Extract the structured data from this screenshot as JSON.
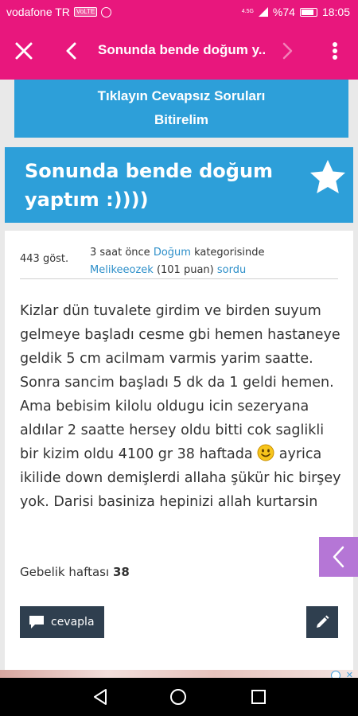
{
  "status_bar": {
    "carrier": "vodafone TR",
    "volte": "VoLTE",
    "network": "4.5G",
    "battery": "%74",
    "time": "18:05"
  },
  "app_bar": {
    "title": "Sonunda bende doğum y...",
    "icons": [
      "close-icon",
      "back-arrow-icon",
      "forward-arrow-icon",
      "more-vert-icon"
    ]
  },
  "banner": {
    "line1": "Tıklayın Cevapsız Soruları",
    "line2": "Bitirelim"
  },
  "question": {
    "title": "Sonunda bende doğum yaptım :))))",
    "views": "443 göst.",
    "meta_prefix": "3 saat önce ",
    "category": "Doğum",
    "meta_category_suffix": " kategorisinde",
    "author": "Melikeeozek",
    "points": " (101 puan) ",
    "asked": "sordu",
    "body_part1": "Kizlar dün tuvalete girdim ve birden suyum gelmeye başladı cesme gbi hemen hastaneye geldik 5 cm acilmam varmis yarim saatte. Sonra sancim başladı  5 dk da 1 geldi hemen. Ama bebisim kilolu oldugu icin sezeryana aldılar 2 saatte hersey oldu bitti cok saglikli bir kizim oldu 4100 gr 38 haftada ",
    "body_part2": " ayrica ikilide down demişlerdi allaha şükür hic birşey yok. Darisi basiniza hepinizi allah kurtarsin",
    "tag_label": "Gebelik haftası ",
    "tag_value": "38"
  },
  "actions": {
    "reply_label": "cevapla"
  },
  "colors": {
    "brand_pink": "#e8177d",
    "brand_blue": "#2d9fd9",
    "dark_button": "#2f3f4f",
    "side_tab": "#b576d6"
  }
}
